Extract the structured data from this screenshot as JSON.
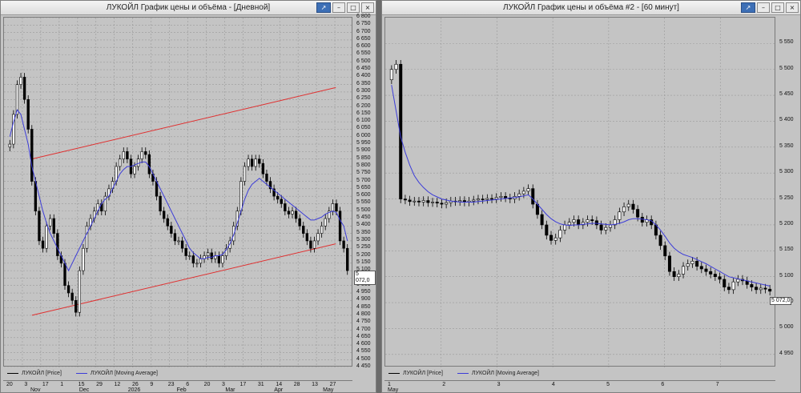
{
  "windows": [
    {
      "title": "ЛУКОЙЛ График цены и объёма - [Дневной]",
      "buttons": [
        "↗",
        "–",
        "□",
        "×"
      ],
      "legend": {
        "price": "ЛУКОЙЛ [Price]",
        "ma": "ЛУКОЙЛ [Moving Average]"
      },
      "last_price_label": "5 072,0",
      "chart_data": {
        "type": "candlestick",
        "ylim": [
          4450,
          6800
        ],
        "y_ticks": [
          "6 800",
          "6 750",
          "6 700",
          "6 650",
          "6 600",
          "6 550",
          "6 500",
          "6 450",
          "6 400",
          "6 350",
          "6 300",
          "6 250",
          "6 200",
          "6 150",
          "6 100",
          "6 050",
          "6 000",
          "5 950",
          "5 900",
          "5 850",
          "5 800",
          "5 750",
          "5 700",
          "5 650",
          "5 600",
          "5 550",
          "5 500",
          "5 450",
          "5 400",
          "5 350",
          "5 300",
          "5 250",
          "5 200",
          "5 150",
          "5 100",
          "5 050",
          "5 000",
          "4 950",
          "4 900",
          "4 850",
          "4 800",
          "4 750",
          "4 700",
          "4 650",
          "4 600",
          "4 550",
          "4 500",
          "4 450"
        ],
        "x_day_labels": [
          "20",
          "3",
          "17",
          "1",
          "15",
          "29",
          "12",
          "26",
          "9",
          "23",
          "6",
          "20",
          "3",
          "17",
          "31",
          "14",
          "28",
          "13",
          "27"
        ],
        "x_month_labels": [
          "Nov",
          "Dec",
          "2026",
          "Feb",
          "Mar",
          "Apr",
          "May"
        ],
        "close": [
          5950,
          6150,
          6350,
          6400,
          6250,
          6050,
          5700,
          5500,
          5300,
          5250,
          5400,
          5450,
          5350,
          5200,
          5150,
          5000,
          4950,
          4900,
          4820,
          5100,
          5250,
          5400,
          5450,
          5500,
          5550,
          5500,
          5600,
          5650,
          5700,
          5800,
          5850,
          5900,
          5850,
          5750,
          5800,
          5850,
          5900,
          5880,
          5750,
          5700,
          5600,
          5500,
          5450,
          5400,
          5350,
          5300,
          5300,
          5250,
          5200,
          5200,
          5150,
          5150,
          5180,
          5200,
          5220,
          5180,
          5200,
          5150,
          5200,
          5250,
          5300,
          5400,
          5500,
          5700,
          5800,
          5850,
          5800,
          5850,
          5820,
          5750,
          5700,
          5650,
          5600,
          5580,
          5550,
          5500,
          5480,
          5500,
          5450,
          5400,
          5350,
          5300,
          5250,
          5300,
          5350,
          5400,
          5450,
          5500,
          5550,
          5500,
          5300,
          5250,
          5100
        ],
        "ma": [
          6000,
          6100,
          6180,
          6150,
          6050,
          5950,
          5800,
          5700,
          5600,
          5500,
          5420,
          5350,
          5300,
          5250,
          5200,
          5150,
          5100,
          5150,
          5200,
          5250,
          5300,
          5350,
          5400,
          5450,
          5500,
          5550,
          5580,
          5600,
          5650,
          5700,
          5750,
          5780,
          5800,
          5800,
          5810,
          5820,
          5830,
          5830,
          5800,
          5750,
          5700,
          5650,
          5600,
          5550,
          5500,
          5450,
          5400,
          5350,
          5300,
          5250,
          5220,
          5200,
          5180,
          5180,
          5190,
          5190,
          5200,
          5200,
          5210,
          5240,
          5280,
          5340,
          5420,
          5500,
          5580,
          5640,
          5680,
          5700,
          5720,
          5700,
          5680,
          5660,
          5640,
          5620,
          5600,
          5580,
          5560,
          5540,
          5520,
          5500,
          5480,
          5460,
          5440,
          5440,
          5450,
          5460,
          5480,
          5490,
          5500,
          5490,
          5440,
          5400,
          5300
        ],
        "trendlines": [
          {
            "from": [
              0.08,
              5850
            ],
            "to": [
              0.95,
              6330
            ]
          },
          {
            "from": [
              0.08,
              4800
            ],
            "to": [
              0.95,
              5280
            ]
          }
        ]
      }
    },
    {
      "title": "ЛУКОЙЛ График цены и объёма #2 - [60 минут]",
      "buttons": [
        "↗",
        "–",
        "□",
        "×"
      ],
      "legend": {
        "price": "ЛУКОЙЛ [Price]",
        "ma": "ЛУКОЙЛ [Moving Average]"
      },
      "last_price_label": "5 072,0",
      "chart_data": {
        "type": "candlestick",
        "ylim": [
          4925,
          5600
        ],
        "y_ticks": [
          "5 550",
          "5 500",
          "5 450",
          "5 400",
          "5 350",
          "5 300",
          "5 250",
          "5 200",
          "5 150",
          "5 100",
          "5 050",
          "5 000",
          "4 950"
        ],
        "x_day_labels": [
          "1",
          "2",
          "3",
          "4",
          "5",
          "6",
          "7"
        ],
        "x_month_labels": [
          "May"
        ],
        "close": [
          5500,
          5510,
          5250,
          5248,
          5245,
          5246,
          5244,
          5247,
          5243,
          5244,
          5242,
          5240,
          5243,
          5246,
          5245,
          5247,
          5244,
          5246,
          5248,
          5250,
          5249,
          5251,
          5250,
          5253,
          5255,
          5252,
          5250,
          5255,
          5260,
          5265,
          5270,
          5240,
          5220,
          5200,
          5180,
          5170,
          5175,
          5190,
          5200,
          5205,
          5210,
          5200,
          5205,
          5210,
          5208,
          5200,
          5190,
          5195,
          5200,
          5210,
          5225,
          5235,
          5240,
          5230,
          5215,
          5205,
          5210,
          5200,
          5180,
          5160,
          5140,
          5110,
          5100,
          5105,
          5120,
          5125,
          5130,
          5120,
          5115,
          5110,
          5105,
          5100,
          5095,
          5080,
          5075,
          5090,
          5095,
          5092,
          5085,
          5080,
          5075,
          5078,
          5076,
          5072
        ],
        "ma": [
          5470,
          5420,
          5370,
          5340,
          5315,
          5295,
          5282,
          5272,
          5264,
          5258,
          5254,
          5250,
          5248,
          5246,
          5245,
          5244,
          5244,
          5244,
          5244,
          5245,
          5246,
          5247,
          5248,
          5249,
          5250,
          5251,
          5252,
          5253,
          5254,
          5256,
          5258,
          5250,
          5240,
          5230,
          5220,
          5212,
          5206,
          5202,
          5200,
          5199,
          5200,
          5200,
          5201,
          5202,
          5203,
          5203,
          5202,
          5201,
          5200,
          5201,
          5203,
          5206,
          5210,
          5212,
          5212,
          5211,
          5210,
          5208,
          5200,
          5190,
          5178,
          5165,
          5155,
          5148,
          5143,
          5140,
          5137,
          5133,
          5129,
          5125,
          5120,
          5115,
          5110,
          5105,
          5100,
          5098,
          5096,
          5094,
          5092,
          5090,
          5088,
          5086,
          5084,
          5082
        ]
      }
    }
  ]
}
